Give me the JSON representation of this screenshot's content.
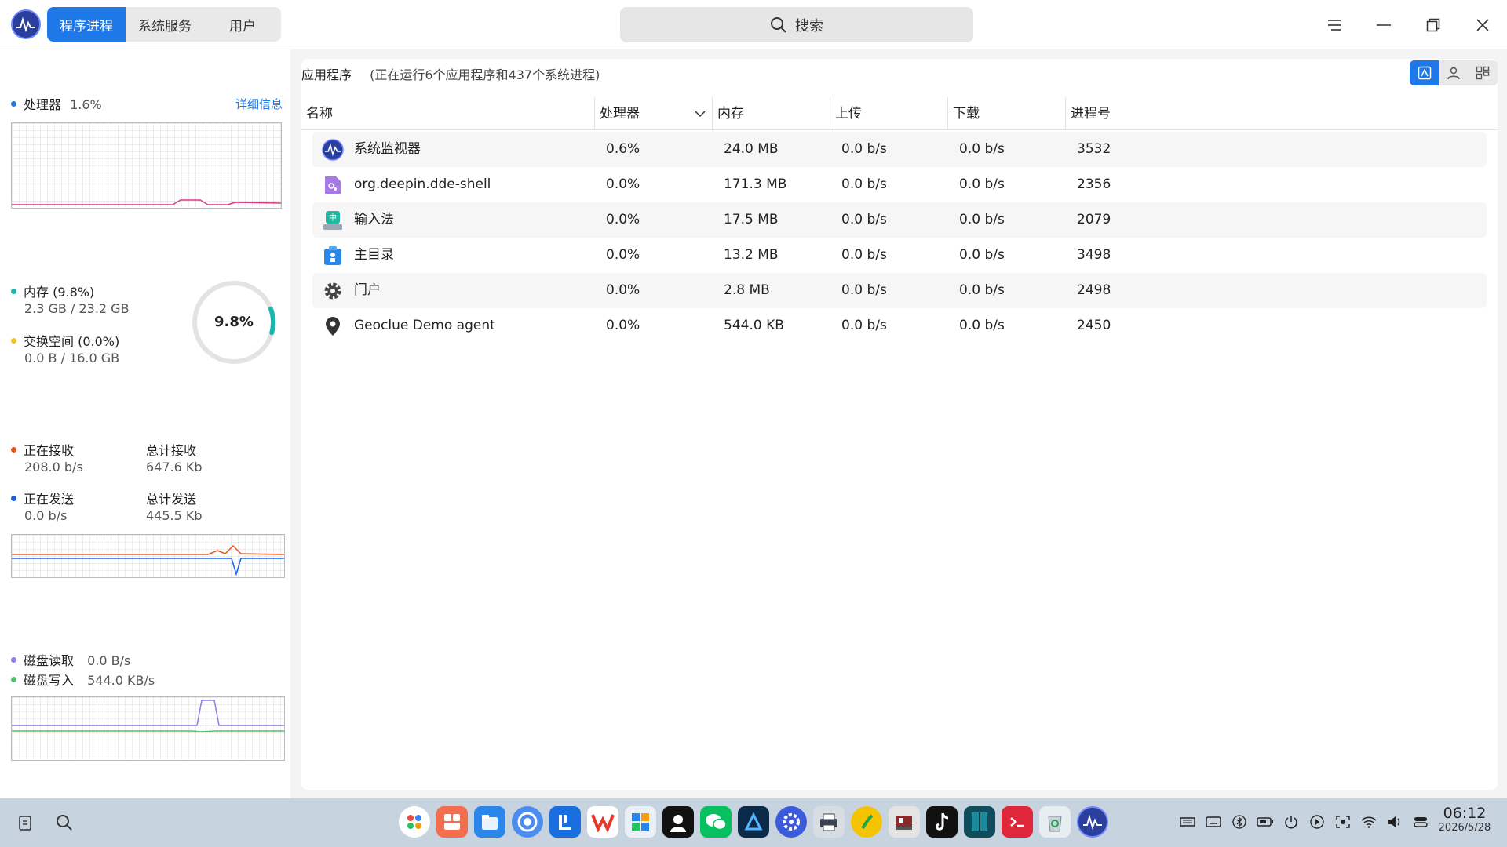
{
  "tabs": [
    {
      "label": "程序进程",
      "active": true
    },
    {
      "label": "系统服务",
      "active": false
    },
    {
      "label": "用户",
      "active": false
    }
  ],
  "search": {
    "label": "搜索"
  },
  "left": {
    "cpu": {
      "label": "处理器",
      "value": "1.6%",
      "detail": "详细信息",
      "color": "#1f78e8",
      "line": "#e0378a"
    },
    "memory": {
      "label": "内存 (9.8%)",
      "usage": "2.3 GB / 23.2 GB",
      "color": "#17b8b0",
      "ring_value": "9.8%",
      "ring_fraction": 0.098
    },
    "swap": {
      "label": "交换空间 (0.0%)",
      "usage": "0.0 B / 16.0 GB",
      "color": "#f0c419"
    },
    "network": {
      "recv_label": "正在接收",
      "recv_value": "208.0 b/s",
      "total_recv_label": "总计接收",
      "total_recv_value": "647.6 Kb",
      "send_label": "正在发送",
      "send_value": "0.0 b/s",
      "total_send_label": "总计发送",
      "total_send_value": "445.5 Kb",
      "recv_color": "#e8561f",
      "send_color": "#1f5ee8"
    },
    "disk": {
      "read_label": "磁盘读取",
      "read_value": "0.0 B/s",
      "write_label": "磁盘写入",
      "write_value": "544.0 KB/s",
      "read_color": "#8b7ee8",
      "write_color": "#4cc46a"
    }
  },
  "main": {
    "section_title": "应用程序",
    "section_count": "(正在运行6个应用程序和437个系统进程)",
    "columns": [
      "名称",
      "处理器",
      "内存",
      "上传",
      "下载",
      "进程号"
    ],
    "rows": [
      {
        "name": "系统监视器",
        "cpu": "0.6%",
        "mem": "24.0 MB",
        "up": "0.0 b/s",
        "down": "0.0 b/s",
        "pid": "3532",
        "icon": "system-monitor-icon"
      },
      {
        "name": "org.deepin.dde-shell",
        "cpu": "0.0%",
        "mem": "171.3 MB",
        "up": "0.0 b/s",
        "down": "0.0 b/s",
        "pid": "2356",
        "icon": "dde-shell-icon"
      },
      {
        "name": "输入法",
        "cpu": "0.0%",
        "mem": "17.5 MB",
        "up": "0.0 b/s",
        "down": "0.0 b/s",
        "pid": "2079",
        "icon": "input-method-icon"
      },
      {
        "name": "主目录",
        "cpu": "0.0%",
        "mem": "13.2 MB",
        "up": "0.0 b/s",
        "down": "0.0 b/s",
        "pid": "3498",
        "icon": "home-folder-icon"
      },
      {
        "name": "门户",
        "cpu": "0.0%",
        "mem": "2.8 MB",
        "up": "0.0 b/s",
        "down": "0.0 b/s",
        "pid": "2498",
        "icon": "gear-icon"
      },
      {
        "name": "Geoclue Demo agent",
        "cpu": "0.0%",
        "mem": "544.0 KB",
        "up": "0.0 b/s",
        "down": "0.0 b/s",
        "pid": "2450",
        "icon": "location-pin-icon"
      }
    ]
  },
  "taskbar": {
    "time": "06:12",
    "date": "2026/5/28"
  }
}
